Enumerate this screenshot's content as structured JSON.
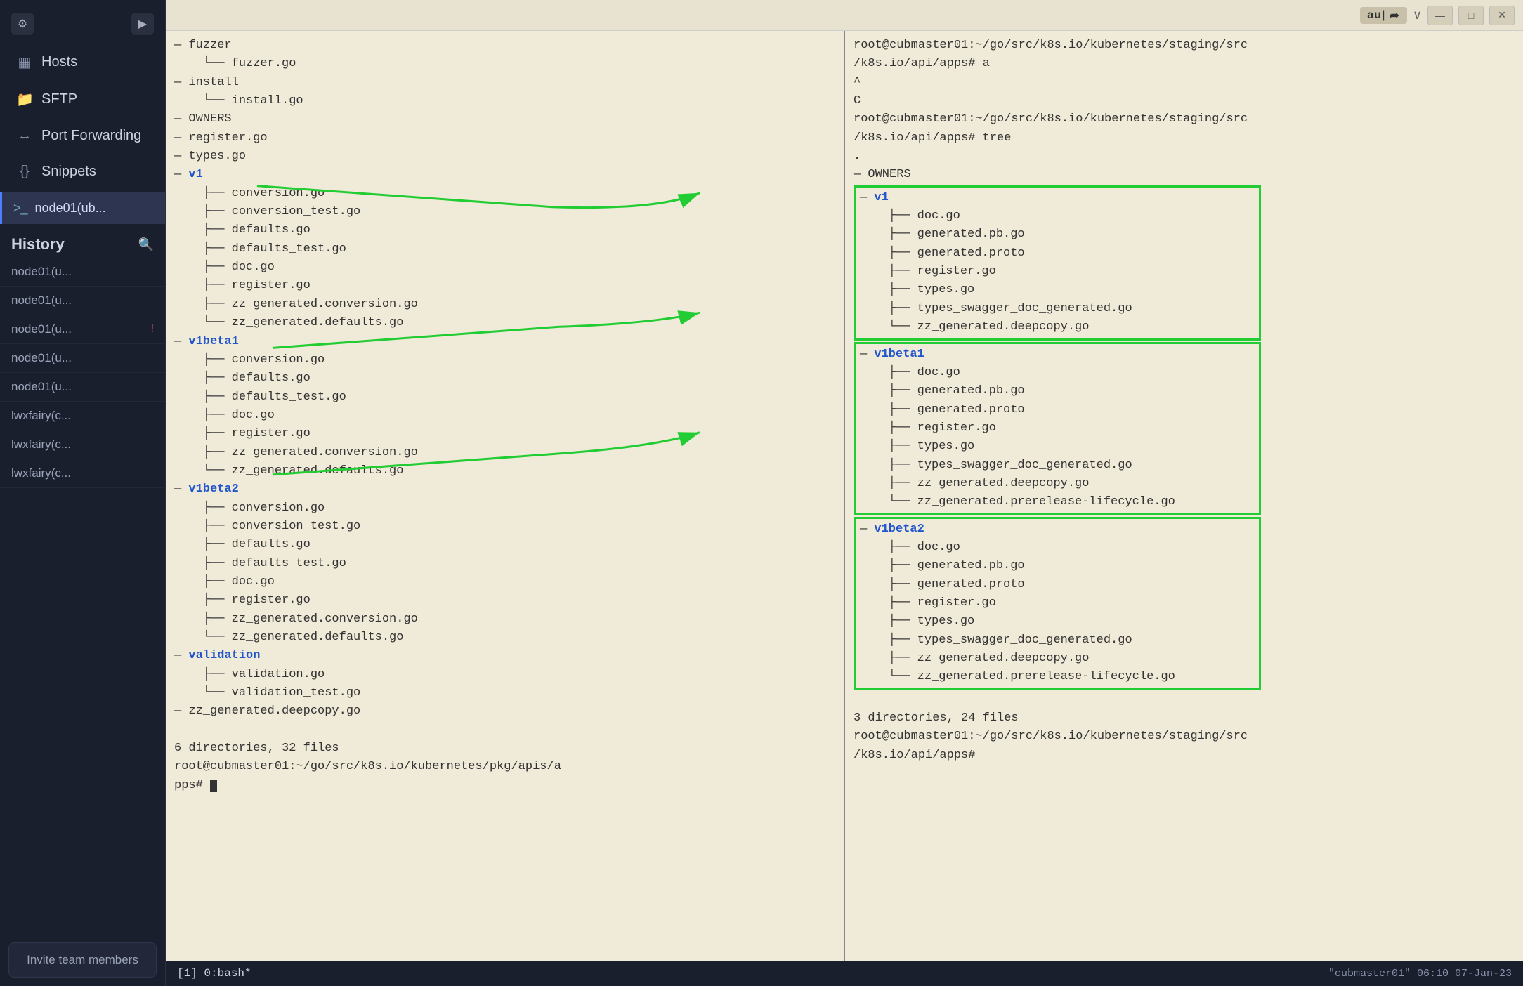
{
  "sidebar": {
    "settings_icon": "⚙",
    "terminal_icon": "▶",
    "hosts_icon": "▦",
    "hosts_label": "Hosts",
    "sftp_icon": "📁",
    "sftp_label": "SFTP",
    "portfwd_icon": "↔",
    "portfwd_label": "Port Forwarding",
    "snippets_icon": "{}",
    "snippets_label": "Snippets",
    "active_terminal_icon": ">_",
    "active_terminal_label": "node01(ub...",
    "history_title": "History",
    "history_search_icon": "🔍",
    "history_items": [
      {
        "label": "node01(u...",
        "alert": false
      },
      {
        "label": "node01(u...",
        "alert": false
      },
      {
        "label": "node01(u...",
        "alert": true
      },
      {
        "label": "node01(u...",
        "alert": false
      },
      {
        "label": "node01(u...",
        "alert": false
      },
      {
        "label": "lwxfairy(c...",
        "alert": false
      },
      {
        "label": "lwxfairy(c...",
        "alert": false
      },
      {
        "label": "lwxfairy(c...",
        "alert": false
      }
    ],
    "invite_label": "Invite team members"
  },
  "titlebar": {
    "au_label": "au|",
    "arrow_icon": "➦",
    "minimize_icon": "—",
    "maximize_icon": "□",
    "close_icon": "✕",
    "chevron_icon": "∨"
  },
  "terminal_left": {
    "lines": [
      "— fuzzer",
      "    └── fuzzer.go",
      "— install",
      "    └── install.go",
      "— OWNERS",
      "— register.go",
      "— types.go",
      "— v1",
      "    ├── conversion.go",
      "    ├── conversion_test.go",
      "    ├── defaults.go",
      "    ├── defaults_test.go",
      "    ├── doc.go",
      "    ├── register.go",
      "    ├── zz_generated.conversion.go",
      "    └── zz_generated.defaults.go",
      "— v1beta1",
      "    ├── conversion.go",
      "    ├── defaults.go",
      "    ├── defaults_test.go",
      "    ├── doc.go",
      "    ├── register.go",
      "    ├── zz_generated.conversion.go",
      "    └── zz_generated.defaults.go",
      "— v1beta2",
      "    ├── conversion.go",
      "    ├── conversion_test.go",
      "    ├── defaults.go",
      "    ├── defaults_test.go",
      "    ├── doc.go",
      "    ├── register.go",
      "    ├── zz_generated.conversion.go",
      "    └── zz_generated.defaults.go",
      "— validation",
      "    ├── validation.go",
      "    └── validation_test.go",
      "— zz_generated.deepcopy.go",
      "",
      "6 directories, 32 files",
      "root@cubmaster01:~/go/src/k8s.io/kubernetes/pkg/apis/a",
      "pps# ▮"
    ],
    "v1_label": "v1",
    "v1beta1_label": "v1beta1",
    "v1beta2_label": "v1beta2",
    "validation_label": "validation"
  },
  "terminal_right": {
    "prompt1": "root@cubmaster01:~/go/src/k8s.io/kubernetes/staging/src",
    "prompt2": "/k8s.io/api/apps# a",
    "caret": "^",
    "char_c": "C",
    "prompt3": "root@cubmaster01:~/go/src/k8s.io/kubernetes/staging/src",
    "prompt4": "/k8s.io/api/apps# tree",
    "dot": ".",
    "owners": "— OWNERS",
    "v1_label": "v1",
    "v1_files": [
      "doc.go",
      "generated.pb.go",
      "generated.proto",
      "register.go",
      "types.go",
      "types_swagger_doc_generated.go",
      "zz_generated.deepcopy.go"
    ],
    "v1beta1_label": "v1beta1",
    "v1beta1_files": [
      "doc.go",
      "generated.pb.go",
      "generated.proto",
      "register.go",
      "types.go",
      "types_swagger_doc_generated.go",
      "zz_generated.deepcopy.go",
      "zz_generated.prerelease-lifecycle.go"
    ],
    "v1beta2_label": "v1beta2",
    "v1beta2_files": [
      "doc.go",
      "generated.pb.go",
      "generated.proto",
      "register.go",
      "types.go",
      "types_swagger_doc_generated.go",
      "zz_generated.deepcopy.go",
      "zz_generated.prerelease-lifecycle.go"
    ],
    "summary": "3 directories, 24 files",
    "final_prompt1": "root@cubmaster01:~/go/src/k8s.io/kubernetes/staging/src",
    "final_prompt2": "/k8s.io/api/apps#"
  },
  "statusbar": {
    "tab_label": "[1] 0:bash*",
    "right_status": "\"cubmaster01\" 06:10 07-Jan-23"
  }
}
